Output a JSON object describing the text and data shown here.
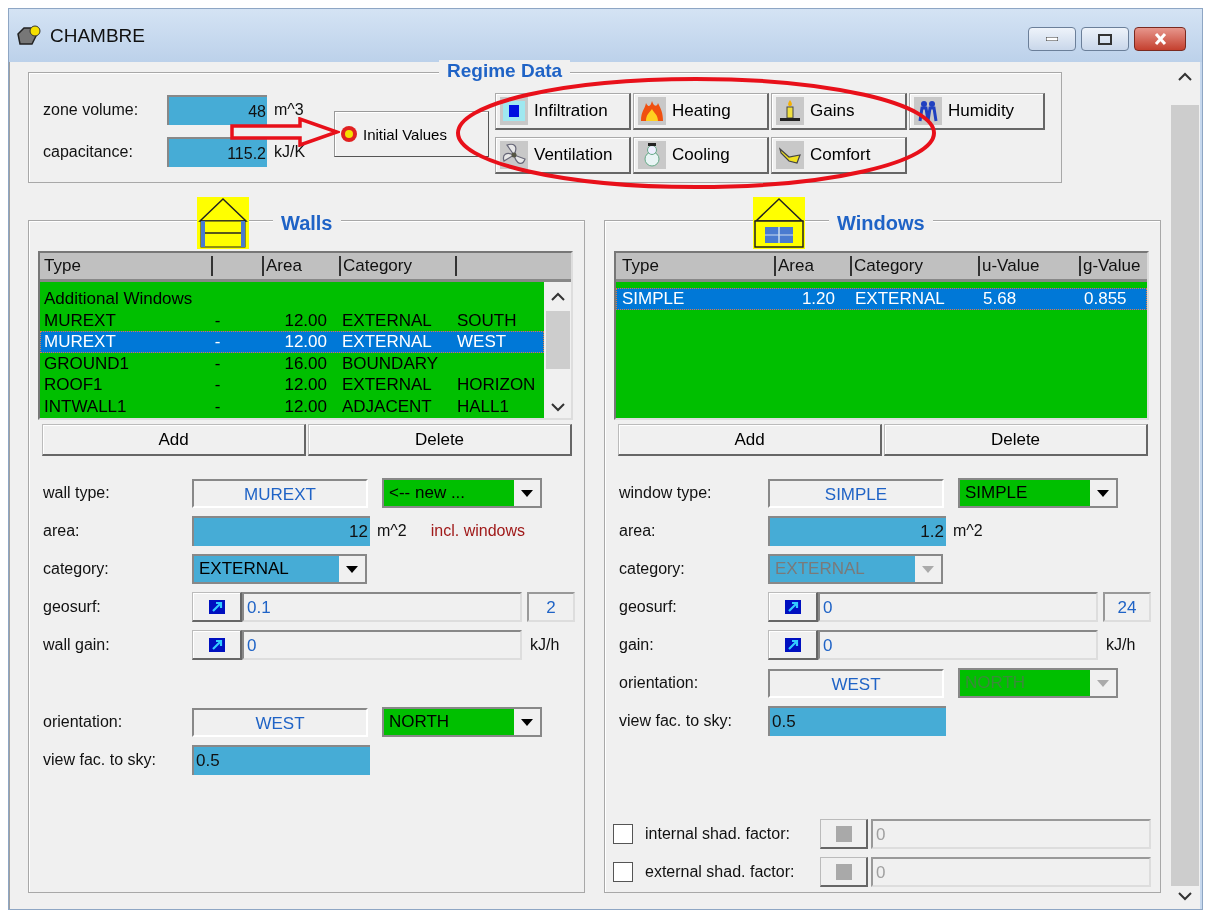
{
  "window": {
    "title": "CHAMBRE"
  },
  "regime": {
    "title": "Regime Data",
    "fields": [
      {
        "label": "zone volume:",
        "value": "48",
        "unit": "m^3"
      },
      {
        "label": "capacitance:",
        "value": "115.2",
        "unit": "kJ/K"
      }
    ],
    "initial_button": "Initial Values",
    "buttons": [
      "Infiltration",
      "Heating",
      "Gains",
      "Humidity",
      "Ventilation",
      "Cooling",
      "Comfort"
    ]
  },
  "walls": {
    "title": "Walls",
    "columns": [
      {
        "label": "Type"
      },
      {},
      {
        "label": "Area"
      },
      {
        "label": "Category"
      },
      {}
    ],
    "rows": [
      {
        "cells": [
          "Additional Windows"
        ],
        "selected": false
      },
      {
        "cells": [
          "MUREXT",
          "-",
          "12.00",
          "EXTERNAL",
          "SOUTH"
        ],
        "selected": false
      },
      {
        "cells": [
          "MUREXT",
          "-",
          "12.00",
          "EXTERNAL",
          "WEST"
        ],
        "selected": true
      },
      {
        "cells": [
          "GROUND1",
          "-",
          "16.00",
          "BOUNDARY"
        ],
        "selected": false
      },
      {
        "cells": [
          "ROOF1",
          "-",
          "12.00",
          "EXTERNAL",
          "HORIZON"
        ],
        "selected": false
      },
      {
        "cells": [
          "INTWALL1",
          "-",
          "12.00",
          "ADJACENT",
          "HALL1"
        ],
        "selected": false
      }
    ],
    "buttons": [
      "Add",
      "Delete"
    ],
    "form": [
      {
        "kind": "type",
        "label": "wall type:",
        "value": "MUREXT",
        "combo": {
          "value": "<-- new ...",
          "disabled": false
        }
      },
      {
        "kind": "number",
        "label": "area:",
        "value": "12",
        "unit": "m^2",
        "note": "incl. windows"
      },
      {
        "kind": "select",
        "label": "category:",
        "value": "EXTERNAL",
        "disabled": false
      },
      {
        "kind": "link",
        "label": "geosurf:",
        "value": "0.1",
        "extra": "2"
      },
      {
        "kind": "link",
        "label": "wall gain:",
        "value": "0",
        "unit": "kJ/h"
      },
      {
        "kind": "type",
        "label": "orientation:",
        "value": "WEST",
        "combo": {
          "value": "NORTH",
          "disabled": false
        },
        "gap_before": true
      },
      {
        "kind": "text",
        "label": "view fac. to sky:",
        "value": "0.5"
      }
    ]
  },
  "windows": {
    "title": "Windows",
    "columns": [
      {
        "label": "Type"
      },
      {
        "label": "Area"
      },
      {
        "label": "Category"
      },
      {
        "label": "u-Value"
      },
      {
        "label": "g-Value"
      }
    ],
    "rows": [
      {
        "cells": [
          "SIMPLE",
          "1.20",
          "EXTERNAL",
          "5.68",
          "0.855"
        ],
        "selected": true
      }
    ],
    "buttons": [
      "Add",
      "Delete"
    ],
    "form": [
      {
        "kind": "type",
        "label": "window type:",
        "value": "SIMPLE",
        "combo": {
          "value": "SIMPLE",
          "disabled": false
        }
      },
      {
        "kind": "number",
        "label": "area:",
        "value": "1.2",
        "unit": "m^2"
      },
      {
        "kind": "select",
        "label": "category:",
        "value": "EXTERNAL",
        "disabled": true
      },
      {
        "kind": "link",
        "label": "geosurf:",
        "value": "0",
        "extra": "24"
      },
      {
        "kind": "link",
        "label": "gain:",
        "value": "0",
        "unit": "kJ/h"
      },
      {
        "kind": "type",
        "label": "orientation:",
        "value": "WEST",
        "combo": {
          "value": "NORTH",
          "disabled": true
        }
      },
      {
        "kind": "text",
        "label": "view fac. to sky:",
        "value": "0.5"
      }
    ],
    "shading": [
      {
        "label": "internal shad. factor:",
        "checked": false,
        "value": "0",
        "disabled": true
      },
      {
        "label": "external shad. factor:",
        "checked": false,
        "value": "0",
        "disabled": true
      }
    ]
  }
}
